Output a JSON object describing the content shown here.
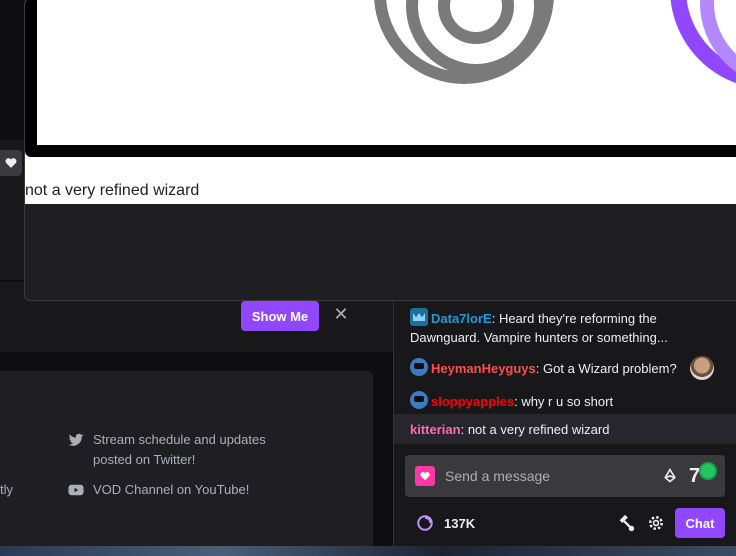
{
  "overlay": {
    "caption": "not a very refined wizard"
  },
  "banner": {
    "show_me_label": "Show Me",
    "close_glyph": "✕"
  },
  "panel": {
    "twitter_text": "Stream schedule and updates posted on Twitter!",
    "youtube_text": "VOD Channel on YouTube!",
    "edge_text": "tly"
  },
  "chat": {
    "messages": [
      {
        "user": "Data7lorE",
        "user_color": "#1e9bd7",
        "sep": ":",
        "text": " Heard they're reforming the Dawnguard. Vampire hunters or something...",
        "badge": "crown-icon"
      },
      {
        "user": "HeymanHeyguys",
        "user_color": "#ff4d4d",
        "sep": ":",
        "text": " Got a Wizard problem?",
        "badge": "glitch-icon"
      },
      {
        "user": "sloppyapples",
        "user_color": "#ff0000",
        "sep": ":",
        "text": " why r u so short",
        "badge": "glitch-icon"
      },
      {
        "user": "kitterian",
        "user_color": "#ff69b4",
        "sep": ":",
        "text": " not a very refined wizard",
        "badge": ""
      }
    ],
    "input_placeholder": "Send a message",
    "points": "137K",
    "chat_button_label": "Chat"
  },
  "colors": {
    "accent": "#9147ff",
    "background": "#0e0e10",
    "panel": "#1f1f23"
  }
}
